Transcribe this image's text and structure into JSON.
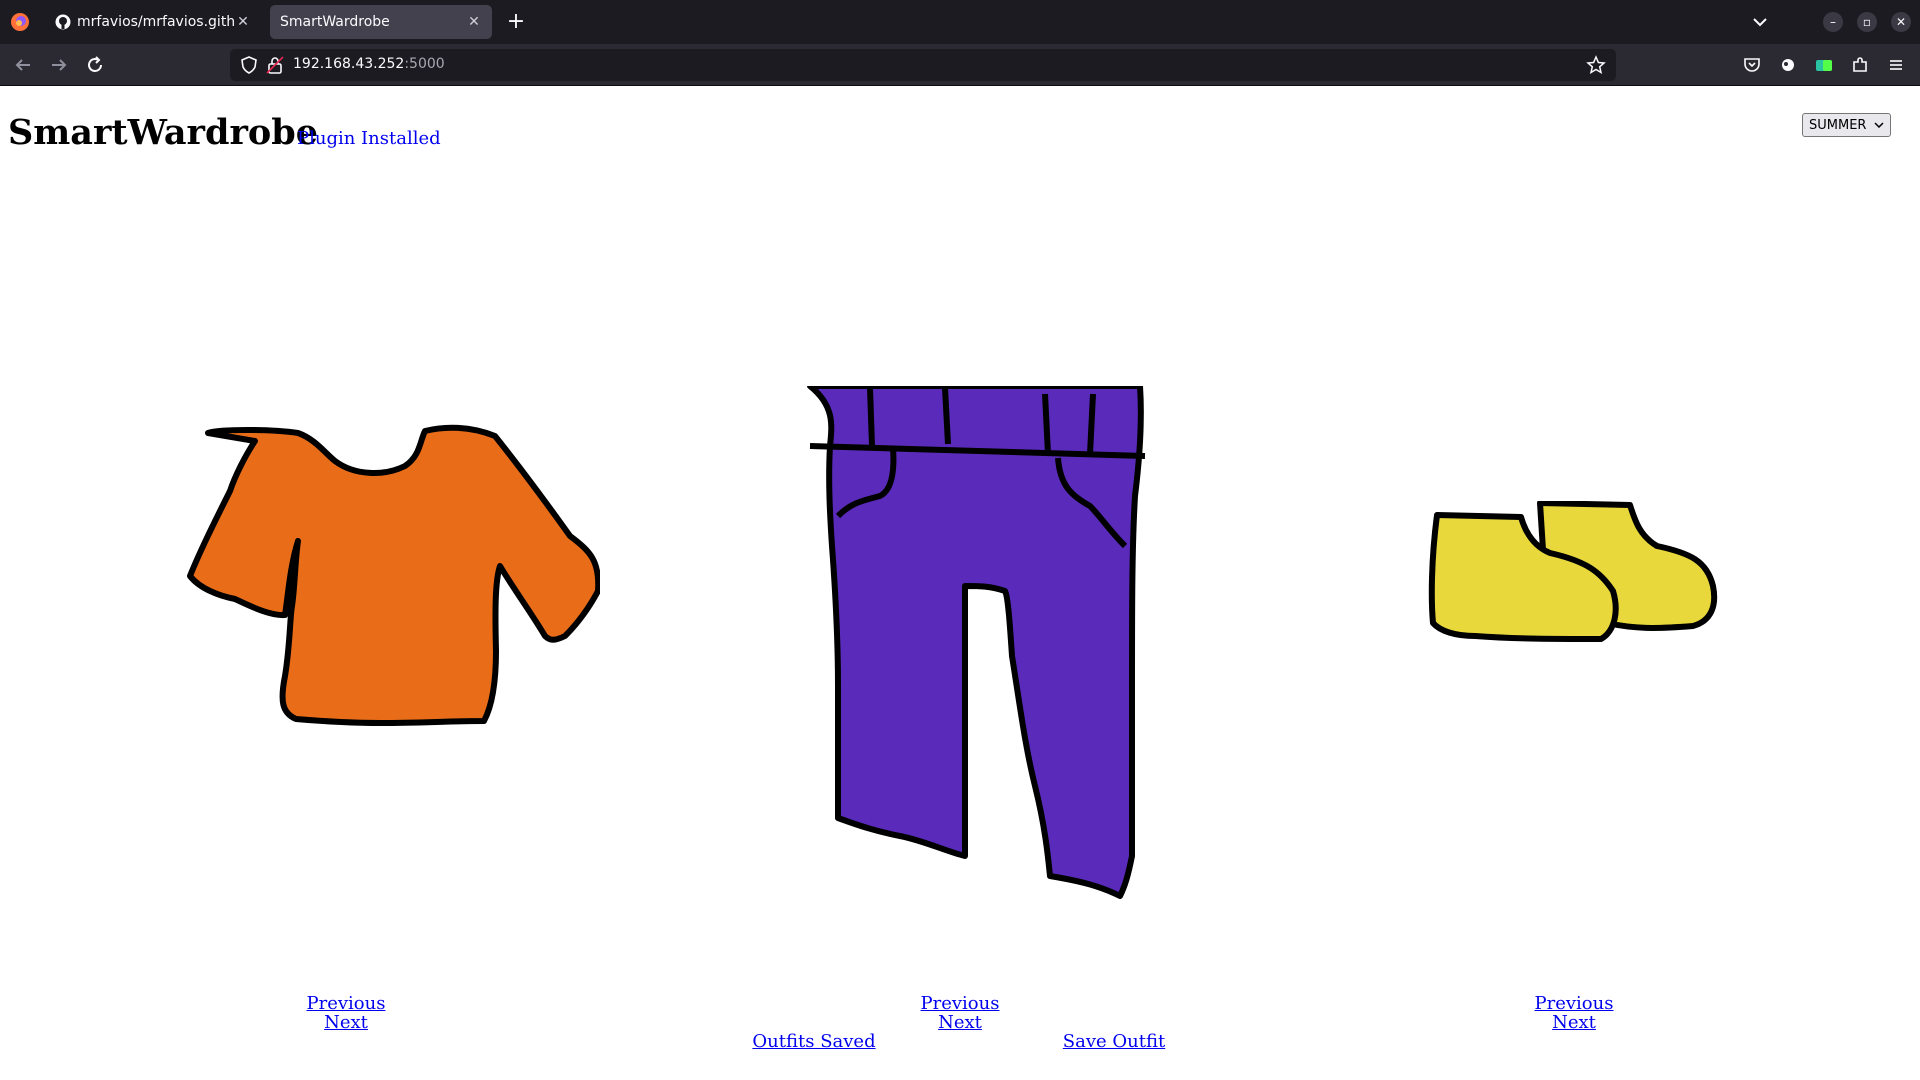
{
  "browser": {
    "tabs": [
      {
        "label": "mrfavios/mrfavios.githu"
      },
      {
        "label": "SmartWardrobe"
      }
    ],
    "url_host": "192.168.43.252",
    "url_port": ":5000"
  },
  "header": {
    "title": "SmartWardrobe",
    "plugin_status": "Plugin Installed",
    "season": "SUMMER"
  },
  "garments": {
    "top": {
      "item": "orange shirt",
      "previous": "Previous",
      "next": "Next"
    },
    "bottom": {
      "item": "purple pants",
      "previous": "Previous",
      "next": "Next"
    },
    "shoes": {
      "item": "yellow shoes",
      "previous": "Previous",
      "next": "Next"
    }
  },
  "actions": {
    "outfits_saved": "Outfits Saved",
    "save_outfit": "Save Outfit"
  },
  "colors": {
    "shirt": "#e96d18",
    "pants": "#5a2bbb",
    "shoes": "#e8d83c"
  }
}
